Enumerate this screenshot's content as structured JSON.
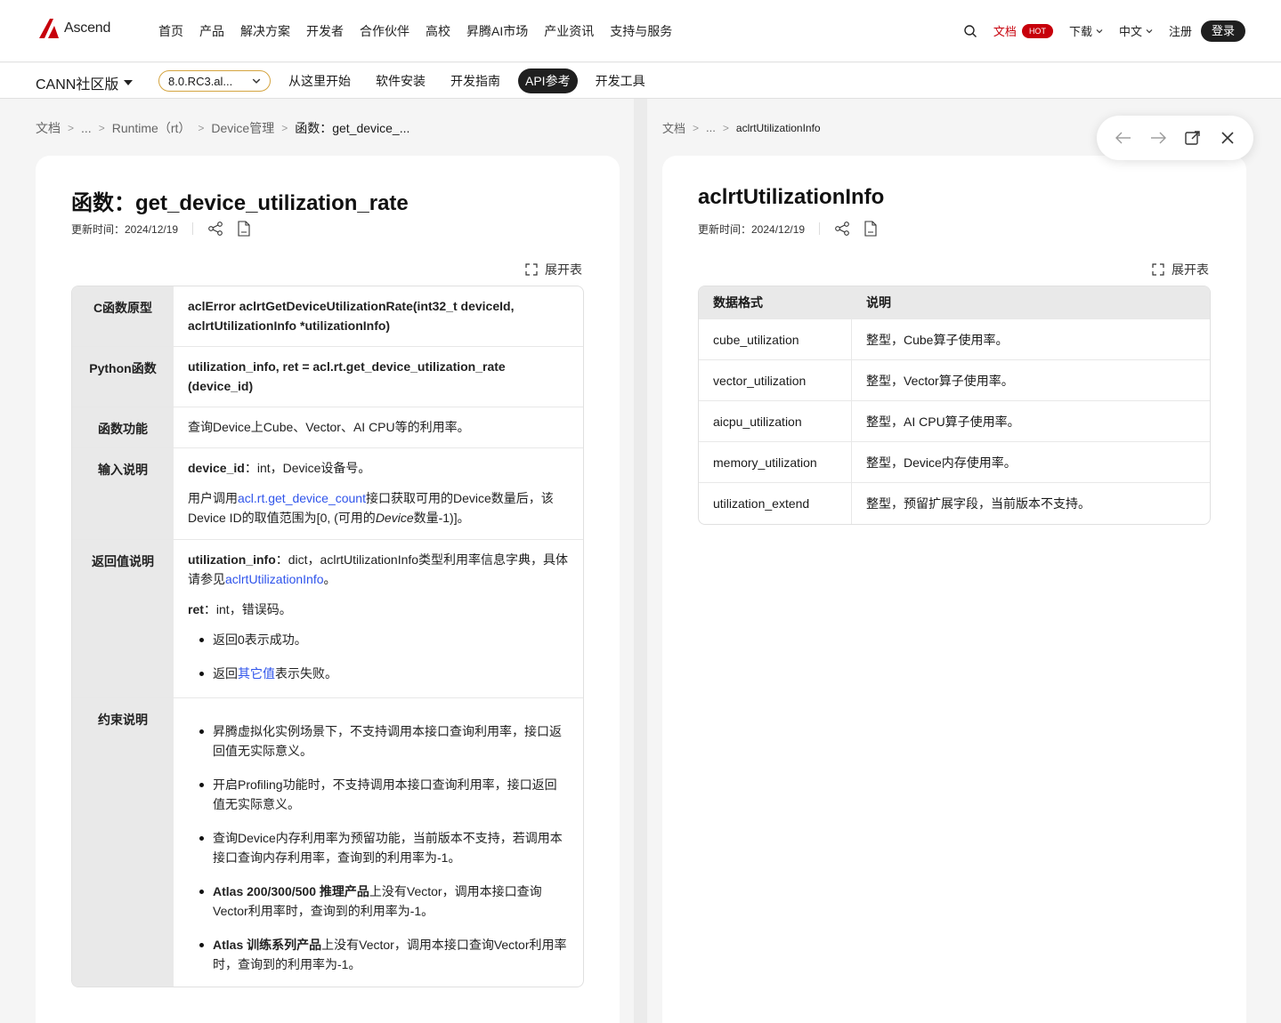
{
  "brand": {
    "name": "Ascend",
    "accent": "#c7000b"
  },
  "topnav": {
    "items": [
      "首页",
      "产品",
      "解决方案",
      "开发者",
      "合作伙伴",
      "高校",
      "昇腾AI市场",
      "产业资讯",
      "支持与服务"
    ],
    "docs": "文档",
    "hot": "HOT",
    "download": "下载",
    "language": "中文",
    "register": "注册",
    "login": "登录"
  },
  "subnav": {
    "product": "CANN社区版",
    "version": "8.0.RC3.al...",
    "tabs": [
      "从这里开始",
      "软件安装",
      "开发指南",
      "API参考",
      "开发工具"
    ],
    "active_tab": "API参考"
  },
  "left": {
    "breadcrumb": [
      "文档",
      "...",
      "Runtime（rt）",
      "Device管理",
      "函数：get_device_..."
    ],
    "title": "函数：get_device_utilization_rate",
    "updated": "更新时间：2024/12/19",
    "expand": "展开表",
    "table": {
      "proto_h": "C函数原型",
      "proto": "aclError aclrtGetDeviceUtilizationRate(int32_t deviceId, aclrtUtilizationInfo *utilizationInfo)",
      "py_h": "Python函数",
      "py": "utilization_info, ret = acl.rt.get_device_utilization_rate (device_id)",
      "func_h": "函数功能",
      "func": "查询Device上Cube、Vector、AI CPU等的利用率。",
      "input_h": "输入说明",
      "input_name": "device_id",
      "input_desc": "：int，Device设备号。",
      "input_p2a": "用户调用",
      "input_link": "acl.rt.get_device_count",
      "input_p2b": "接口获取可用的Device数量后，该Device ID的取值范围为[0, (可用的",
      "input_p2i": "Device",
      "input_p2c": "数量-1)]。",
      "ret_h": "返回值说明",
      "ret_name": "utilization_info",
      "ret_desc": "：dict，aclrtUtilizationInfo类型利用率信息字典，具体请参见",
      "ret_link": "aclrtUtilizationInfo",
      "ret_end": "。",
      "ret2_name": "ret",
      "ret2_desc": "：int，错误码。",
      "ret_b1": "返回0表示成功。",
      "ret_b2a": "返回",
      "ret_b2link": "其它值",
      "ret_b2b": "表示失败。",
      "cons_h": "约束说明",
      "cons1": "昇腾虚拟化实例场景下，不支持调用本接口查询利用率，接口返回值无实际意义。",
      "cons2": "开启Profiling功能时，不支持调用本接口查询利用率，接口返回值无实际意义。",
      "cons3": "查询Device内存利用率为预留功能，当前版本不支持，若调用本接口查询内存利用率，查询到的利用率为-1。",
      "cons4_b": "Atlas 200/300/500 推理产品",
      "cons4": "上没有Vector，调用本接口查询Vector利用率时，查询到的利用率为-1。",
      "cons5_b": "Atlas 训练系列产品",
      "cons5": "上没有Vector，调用本接口查询Vector利用率时，查询到的利用率为-1。"
    }
  },
  "right": {
    "breadcrumb": [
      "文档",
      "...",
      "aclrtUtilizationInfo"
    ],
    "title": "aclrtUtilizationInfo",
    "updated": "更新时间：2024/12/19",
    "expand": "展开表",
    "headers": [
      "数据格式",
      "说明"
    ],
    "rows": [
      [
        "cube_utilization",
        "整型，Cube算子使用率。"
      ],
      [
        "vector_utilization",
        "整型，Vector算子使用率。"
      ],
      [
        "aicpu_utilization",
        "整型，AI CPU算子使用率。"
      ],
      [
        "memory_utilization",
        "整型，Device内存使用率。"
      ],
      [
        "utilization_extend",
        "整型，预留扩展字段，当前版本不支持。"
      ]
    ]
  }
}
